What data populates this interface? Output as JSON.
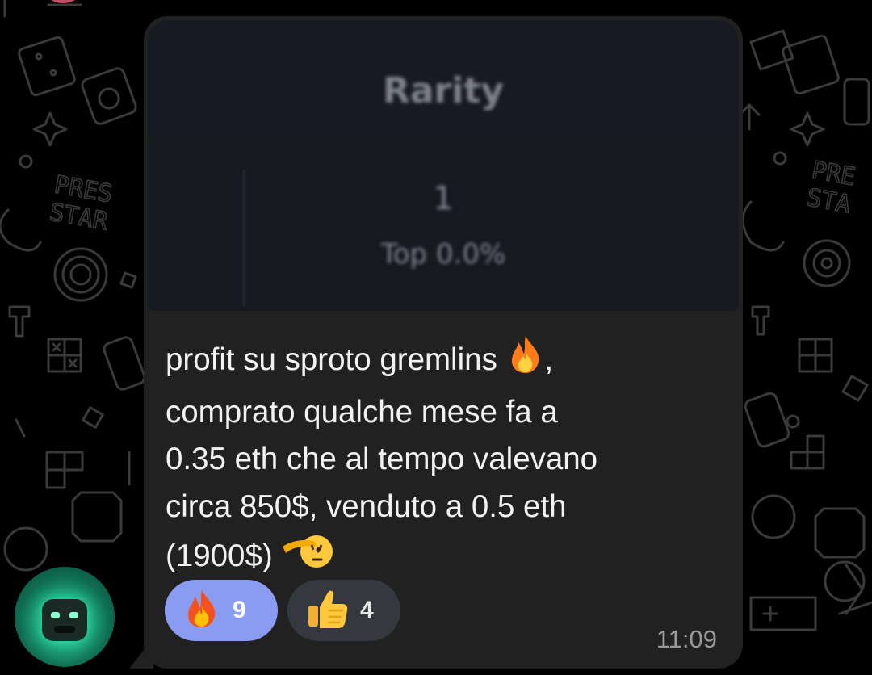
{
  "post_image": {
    "heading": "Rarity",
    "rank": "1",
    "top": "Top 0.0%"
  },
  "message": {
    "line1": "profit su sproto gremlins",
    "line1_after": ",",
    "line2": "comprato qualche mese fa a",
    "line3": "0.35 eth che al tempo valevano",
    "line4": "circa 850$, venduto a 0.5 eth",
    "line5": "(1900$)",
    "emojis": [
      "fire-emoji",
      "saluting-face-emoji"
    ]
  },
  "reactions": [
    {
      "emoji": "fire-emoji",
      "count": "9",
      "active": true
    },
    {
      "emoji": "thumbs-up-emoji",
      "count": "4",
      "active": false
    }
  ],
  "timestamp": "11:09",
  "colors": {
    "bubble": "#212121",
    "active_reaction": "#8a9bf2",
    "inactive_reaction": "#35383e",
    "background": "#000000"
  }
}
